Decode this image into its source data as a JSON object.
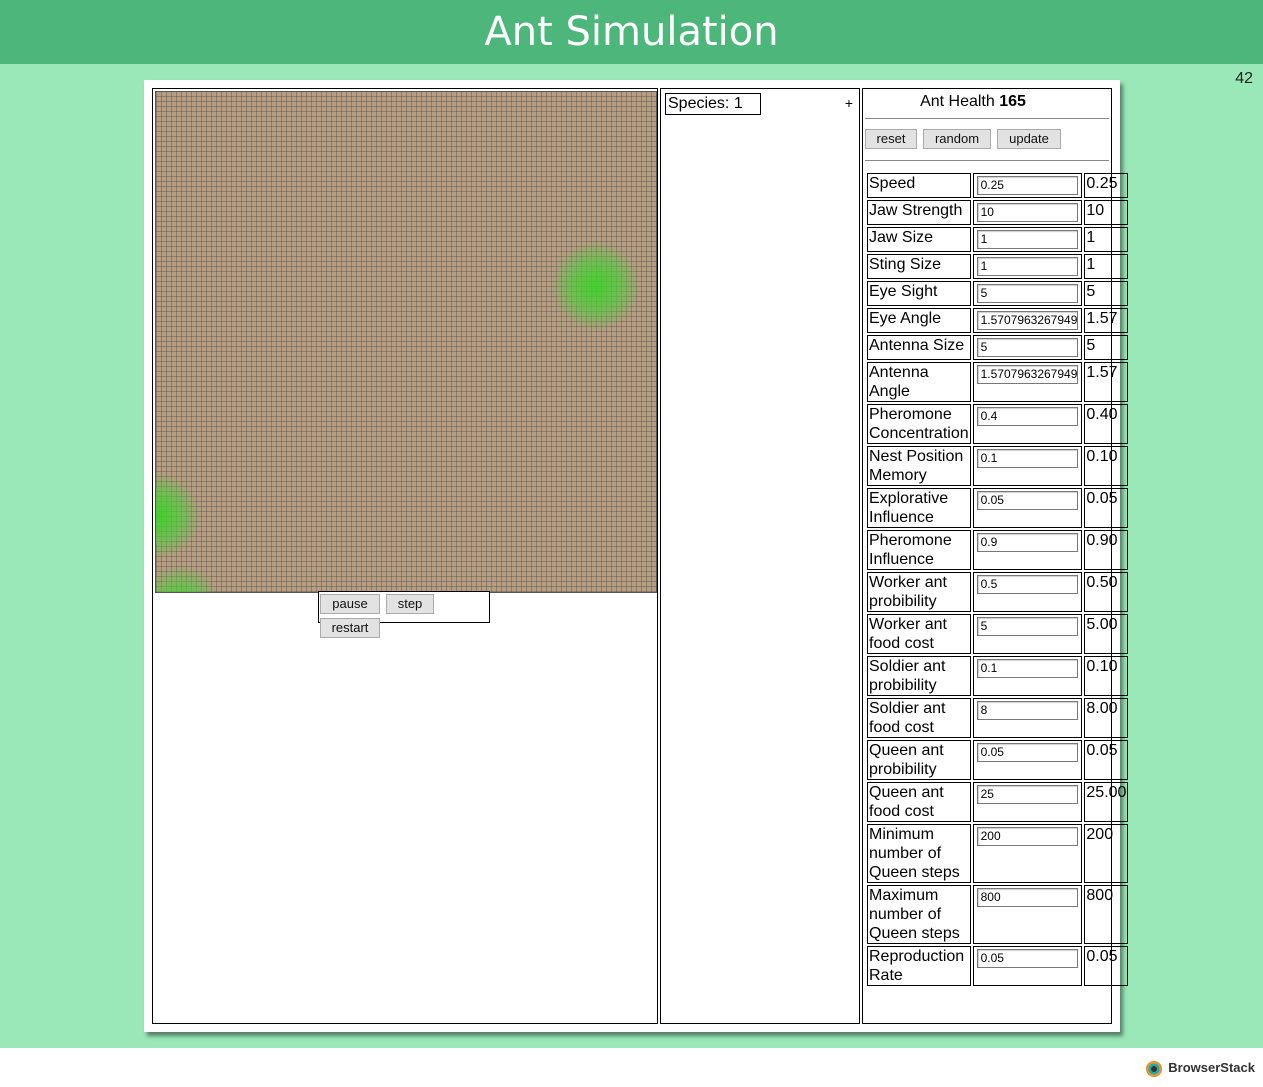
{
  "header": {
    "title": "Ant Simulation"
  },
  "page_counter": "42",
  "sim_controls": {
    "pause_label": "pause",
    "step_label": "step",
    "restart_label": "restart"
  },
  "species": {
    "label": "Species: 1",
    "add_label": "+"
  },
  "ant_health": {
    "label": "Ant Health",
    "value": "165"
  },
  "param_actions": {
    "reset_label": "reset",
    "random_label": "random",
    "update_label": "update"
  },
  "params": [
    {
      "label": "Speed",
      "input": "0.25",
      "value": "0.25"
    },
    {
      "label": "Jaw Strength",
      "input": "10",
      "value": "10"
    },
    {
      "label": "Jaw Size",
      "input": "1",
      "value": "1"
    },
    {
      "label": "Sting Size",
      "input": "1",
      "value": "1"
    },
    {
      "label": "Eye Sight",
      "input": "5",
      "value": "5"
    },
    {
      "label": "Eye Angle",
      "input": "1.5707963267949",
      "value": "1.57"
    },
    {
      "label": "Antenna Size",
      "input": "5",
      "value": "5"
    },
    {
      "label": "Antenna Angle",
      "input": "1.5707963267949",
      "value": "1.57"
    },
    {
      "label": "Pheromone Concentration",
      "input": "0.4",
      "value": "0.40"
    },
    {
      "label": "Nest Position Memory",
      "input": "0.1",
      "value": "0.10"
    },
    {
      "label": "Explorative Influence",
      "input": "0.05",
      "value": "0.05"
    },
    {
      "label": "Pheromone Influence",
      "input": "0.9",
      "value": "0.90"
    },
    {
      "label": "Worker ant probibility",
      "input": "0.5",
      "value": "0.50"
    },
    {
      "label": "Worker ant food cost",
      "input": "5",
      "value": "5.00"
    },
    {
      "label": "Soldier ant probibility",
      "input": "0.1",
      "value": "0.10"
    },
    {
      "label": "Soldier ant food cost",
      "input": "8",
      "value": "8.00"
    },
    {
      "label": "Queen ant probibility",
      "input": "0.05",
      "value": "0.05"
    },
    {
      "label": "Queen ant food cost",
      "input": "25",
      "value": "25.00"
    },
    {
      "label": "Minimum number of Queen steps",
      "input": "200",
      "value": "200"
    },
    {
      "label": "Maximum number of Queen steps",
      "input": "800",
      "value": "800"
    },
    {
      "label": "Reproduction Rate",
      "input": "0.05",
      "value": "0.05"
    }
  ],
  "footer": {
    "brand": "BrowserStack"
  },
  "colors": {
    "header": "#4db67a",
    "background": "#9ae8b8",
    "ground": "#b59e83",
    "food": "#44cc33"
  }
}
